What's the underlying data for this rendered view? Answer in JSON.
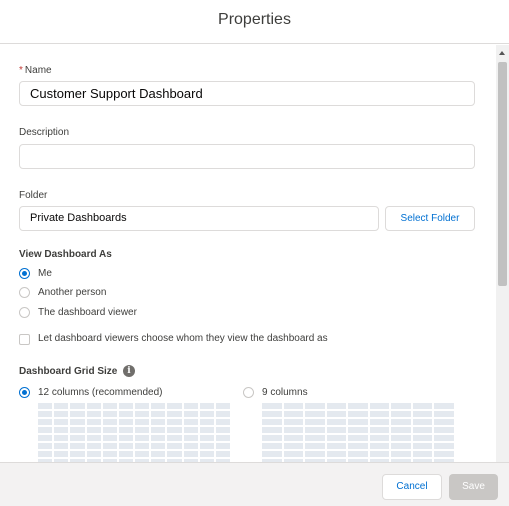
{
  "dialog": {
    "title": "Properties"
  },
  "name_field": {
    "label": "Name",
    "required_mark": "*",
    "value": "Customer Support Dashboard"
  },
  "description_field": {
    "label": "Description",
    "value": ""
  },
  "folder_field": {
    "label": "Folder",
    "value": "Private Dashboards",
    "select_button": "Select Folder"
  },
  "view_as": {
    "title": "View Dashboard As",
    "options": [
      "Me",
      "Another person",
      "The dashboard viewer"
    ],
    "selected": "Me"
  },
  "viewer_checkbox": {
    "label": "Let dashboard viewers choose whom they view the dashboard as",
    "checked": false
  },
  "grid_size": {
    "title": "Dashboard Grid Size",
    "info_icon": "info-icon",
    "options": [
      {
        "label": "12 columns (recommended)",
        "columns": 12,
        "selected": true
      },
      {
        "label": "9 columns",
        "columns": 9,
        "selected": false
      }
    ]
  },
  "footer": {
    "cancel_label": "Cancel",
    "save_label": "Save"
  },
  "colors": {
    "accent": "#0070d2",
    "required": "#c23934",
    "save_disabled": "#c9c7c5",
    "grid_cell": "#e4e9ef"
  }
}
